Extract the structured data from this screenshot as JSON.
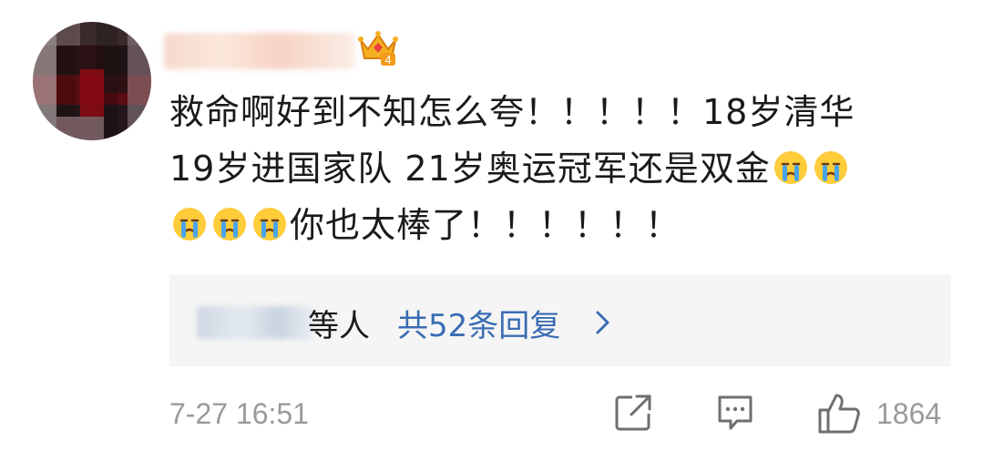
{
  "comment": {
    "line1": "救命啊好到不知怎么夸！！！！！18岁清华",
    "line2": "19岁进国家队 21岁奥运冠军还是双金",
    "line3": "你也太棒了！！！！！！",
    "badge_level": "4"
  },
  "replies": {
    "suffix": "等人",
    "count_label": "共52条回复"
  },
  "meta": {
    "timestamp": "7-27 16:51",
    "like_count": "1864"
  },
  "icons": [
    "crown-badge-icon",
    "crying-emoji-icon",
    "chevron-right-icon",
    "share-icon",
    "comment-icon",
    "like-icon"
  ],
  "colors": {
    "link": "#3a6db3",
    "muted": "#9a9a9a",
    "reply_bg": "#f5f5f5",
    "badge": "#f2a21b"
  }
}
